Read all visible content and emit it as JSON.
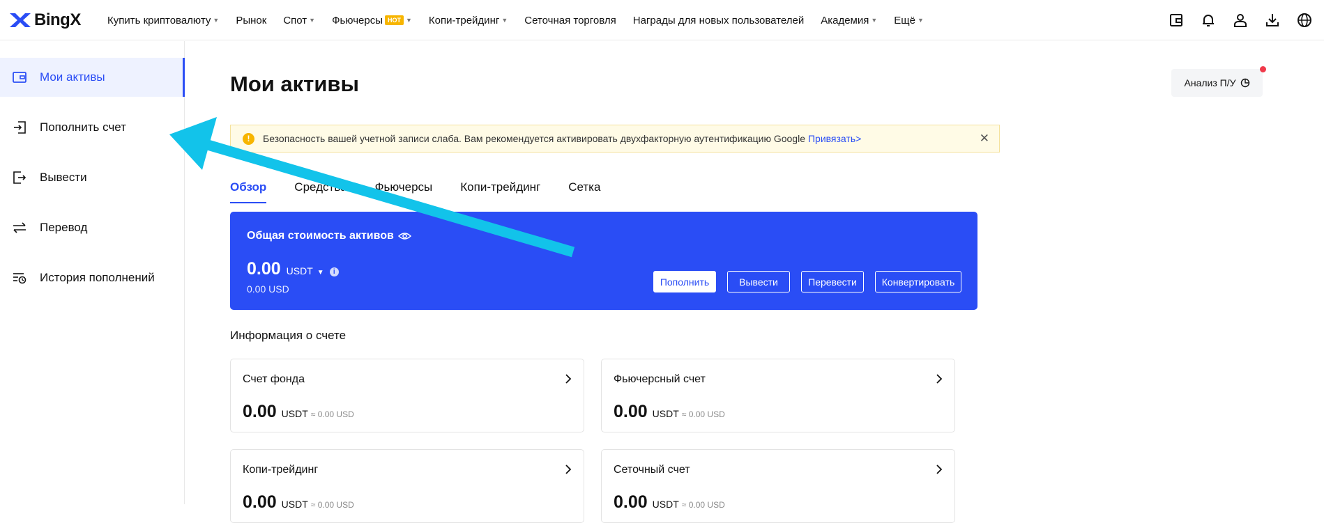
{
  "brand": {
    "name": "BingX"
  },
  "nav": {
    "items": [
      {
        "label": "Купить криптовалюту",
        "caret": true
      },
      {
        "label": "Рынок",
        "caret": false
      },
      {
        "label": "Спот",
        "caret": true
      },
      {
        "label": "Фьючерсы",
        "caret": true,
        "badge": "HOT"
      },
      {
        "label": "Копи-трейдинг",
        "caret": true
      },
      {
        "label": "Сеточная торговля",
        "caret": false
      },
      {
        "label": "Награды для новых пользователей",
        "caret": false
      },
      {
        "label": "Академия",
        "caret": true
      },
      {
        "label": "Ещё",
        "caret": true
      }
    ],
    "icons": [
      "wallet-icon",
      "bell-icon",
      "user-icon",
      "download-icon",
      "globe-icon"
    ]
  },
  "sidebar": {
    "items": [
      {
        "label": "Мои активы",
        "icon": "wallet-icon",
        "active": true
      },
      {
        "label": "Пополнить счет",
        "icon": "deposit-icon",
        "active": false
      },
      {
        "label": "Вывести",
        "icon": "withdraw-icon",
        "active": false
      },
      {
        "label": "Перевод",
        "icon": "transfer-icon",
        "active": false
      },
      {
        "label": "История пополнений",
        "icon": "history-icon",
        "active": false
      }
    ]
  },
  "main": {
    "title": "Мои активы",
    "pnl_button": "Анализ П/У",
    "alert": {
      "text": "Безопасность вашей учетной записи слаба. Вам рекомендуется активировать двухфакторную аутентификацию Google",
      "link": "Привязать>"
    },
    "tabs": [
      {
        "label": "Обзор",
        "active": true
      },
      {
        "label": "Средства",
        "active": false
      },
      {
        "label": "Фьючерсы",
        "active": false
      },
      {
        "label": "Копи-трейдинг",
        "active": false
      },
      {
        "label": "Сетка",
        "active": false
      }
    ],
    "total": {
      "label": "Общая стоимость активов",
      "value": "0.00",
      "unit": "USDT",
      "usd": "0.00 USD",
      "buttons": {
        "deposit": "Пополнить",
        "withdraw": "Вывести",
        "transfer": "Перевести",
        "convert": "Конвертировать"
      }
    },
    "account_info_title": "Информация о счете",
    "accounts": [
      {
        "name": "Счет фонда",
        "value": "0.00",
        "unit": "USDT",
        "usd": "≈ 0.00 USD"
      },
      {
        "name": "Фьючерсный счет",
        "value": "0.00",
        "unit": "USDT",
        "usd": "≈ 0.00 USD"
      },
      {
        "name": "Копи-трейдинг",
        "value": "0.00",
        "unit": "USDT",
        "usd": "≈ 0.00 USD"
      },
      {
        "name": "Сеточный счет",
        "value": "0.00",
        "unit": "USDT",
        "usd": "≈ 0.00 USD"
      }
    ]
  },
  "colors": {
    "accent": "#2a4df5",
    "annotation_arrow": "#12c3ea",
    "alert_bg": "#fffbe6",
    "hot_badge": "#f7b500"
  }
}
